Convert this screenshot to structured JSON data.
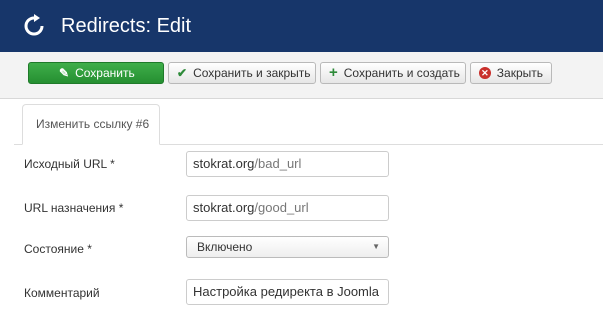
{
  "header": {
    "title": "Redirects: Edit",
    "icon": "refresh-icon",
    "background": "#17366a"
  },
  "toolbar": {
    "save_label": "Сохранить",
    "save_close_label": "Сохранить и закрыть",
    "save_new_label": "Сохранить и создать",
    "close_label": "Закрыть"
  },
  "tab": {
    "label": "Изменить ссылку #6"
  },
  "form": {
    "source_url": {
      "label": "Исходный URL *",
      "host": "stokrat.org",
      "path": "/bad_url"
    },
    "target_url": {
      "label": "URL назначения *",
      "host": "stokrat.org",
      "path": "/good_url"
    },
    "state": {
      "label": "Состояние *",
      "value": "Включено"
    },
    "comment": {
      "label": "Комментарий",
      "value": "Настройка редиректа в Joomla"
    }
  }
}
